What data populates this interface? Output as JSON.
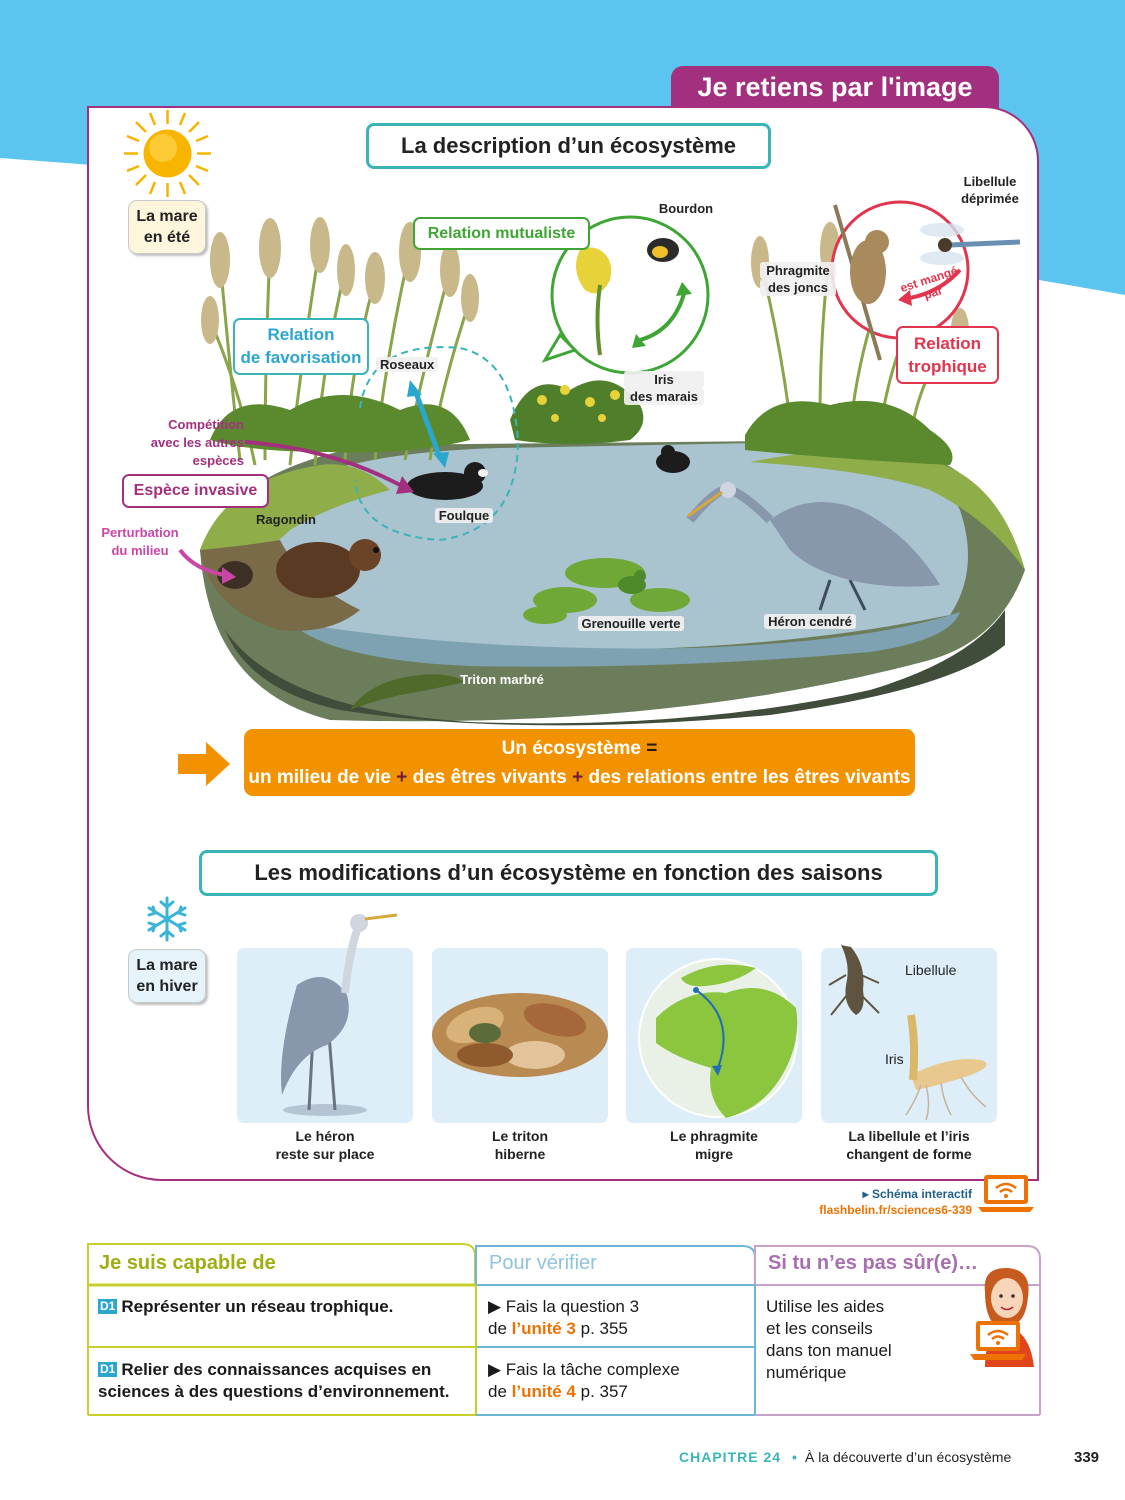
{
  "header": {
    "tab_title": "Je retiens par l'image"
  },
  "section1": {
    "title": "La description d’un écosystème",
    "season_label_line1": "La mare",
    "season_label_line2": "en été"
  },
  "relations": {
    "mutualist": "Relation mutualiste",
    "favorisation_line1": "Relation",
    "favorisation_line2": "de favorisation",
    "trophic_line1": "Relation",
    "trophic_line2": "trophique",
    "invasive": "Espèce invasive",
    "competition_line1": "Compétition",
    "competition_line2": "avec les autres",
    "competition_line3": "espèces",
    "perturbation_line1": "Perturbation",
    "perturbation_line2": "du milieu",
    "eaten_by_line1": "est mangé",
    "eaten_by_line2": "par"
  },
  "species_labels": {
    "bourdon": "Bourdon",
    "libellule_line1": "Libellule",
    "libellule_line2": "déprimée",
    "phragmite_line1": "Phragmite",
    "phragmite_line2": "des joncs",
    "roseaux": "Roseaux",
    "iris_line1": "Iris",
    "iris_line2": "des marais",
    "foulque": "Foulque",
    "ragondin": "Ragondin",
    "grenouille": "Grenouille verte",
    "heron": "Héron cendré",
    "triton": "Triton marbré"
  },
  "definition": {
    "line1_text": "Un écosystème",
    "line1_eq": "=",
    "part1": "un milieu de vie",
    "plus1": "+",
    "part2": "des êtres vivants",
    "plus2": "+",
    "part3": "des relations entre les êtres vivants"
  },
  "section2": {
    "title": "Les modifications d’un écosystème en fonction des saisons",
    "season_label_line1": "La mare",
    "season_label_line2": "en hiver",
    "card4_label_libellule": "Libellule",
    "card4_label_iris": "Iris",
    "captions": [
      {
        "line1": "Le héron",
        "line2": "reste sur place"
      },
      {
        "line1": "Le triton",
        "line2": "hiberne"
      },
      {
        "line1": "Le phragmite",
        "line2": "migre"
      },
      {
        "line1": "La libellule et l’iris",
        "line2": "changent de forme"
      }
    ]
  },
  "interactive": {
    "label": "Schéma interactif",
    "url": "flashbelin.fr/sciences6-339"
  },
  "skills": {
    "col1_header": "Je suis capable de",
    "col2_header": "Pour vérifier",
    "col3_header": "Si tu n’es pas sûr(e)…",
    "badge": "D1",
    "rows": [
      {
        "skill": "Représenter un réseau trophique.",
        "check_prefix": "Fais la question 3",
        "check_de": "de",
        "check_unit": "l’unité 3",
        "check_page": "p. 355"
      },
      {
        "skill_line1": "Relier des connaissances acquises en",
        "skill_line2": "sciences à des questions d’environnement.",
        "check_prefix": "Fais la tâche complexe",
        "check_de": "de",
        "check_unit": "l’unité 4",
        "check_page": "p. 357"
      }
    ],
    "help_line1": "Utilise les aides",
    "help_line2": "et les conseils",
    "help_line3": "dans ton manuel",
    "help_line4": "numérique"
  },
  "footer": {
    "chapter": "CHAPITRE 24",
    "bullet": "•",
    "chapter_title": "À la découverte d’un écosystème",
    "page_number": "339"
  },
  "colors": {
    "sky": "#5bc4ef",
    "magenta": "#a2307e",
    "teal": "#3ab4b6",
    "green": "#3fa535",
    "red": "#e2354d",
    "orange": "#f39200",
    "cyan": "#2aa6cf"
  }
}
